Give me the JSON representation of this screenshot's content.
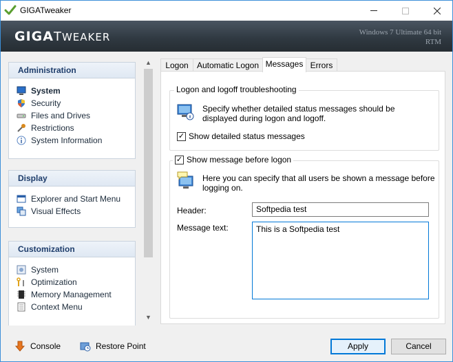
{
  "window": {
    "title": "GIGATweaker",
    "brand_first": "GIGA",
    "brand_t": "T",
    "brand_rest": "WEAKER",
    "os_line1": "Windows 7 Ultimate 64 bit",
    "os_line2": "RTM"
  },
  "sidebar": {
    "panels": [
      {
        "title": "Administration",
        "items": [
          {
            "label": "System",
            "icon": "monitor-icon",
            "selected": true
          },
          {
            "label": "Security",
            "icon": "shield-icon"
          },
          {
            "label": "Files and Drives",
            "icon": "drive-icon"
          },
          {
            "label": "Restrictions",
            "icon": "tools-icon"
          },
          {
            "label": "System Information",
            "icon": "info-icon"
          }
        ]
      },
      {
        "title": "Display",
        "items": [
          {
            "label": "Explorer and Start Menu",
            "icon": "explorer-icon"
          },
          {
            "label": "Visual Effects",
            "icon": "effects-icon"
          }
        ]
      },
      {
        "title": "Customization",
        "items": [
          {
            "label": "System",
            "icon": "system-settings-icon"
          },
          {
            "label": "Optimization",
            "icon": "wrench-icon"
          },
          {
            "label": "Memory Management",
            "icon": "memory-chip-icon"
          },
          {
            "label": "Context Menu",
            "icon": "context-menu-icon"
          }
        ]
      }
    ]
  },
  "tabs": [
    {
      "label": "Logon"
    },
    {
      "label": "Automatic Logon"
    },
    {
      "label": "Messages",
      "active": true
    },
    {
      "label": "Errors"
    }
  ],
  "messages": {
    "troubleshoot_title": "Logon and logoff troubleshooting",
    "troubleshoot_desc_1": "Specify whether detailed status messages should be",
    "troubleshoot_desc_2": "displayed during logon and logoff.",
    "show_detailed_label": "Show detailed status messages",
    "show_detailed_checked": true,
    "show_message_label": "Show message before logon",
    "show_message_checked": true,
    "message_desc_1": "Here you can specify that all users be shown a message before",
    "message_desc_2": "logging on.",
    "header_label": "Header:",
    "header_value": "Softpedia test",
    "message_text_label": "Message text:",
    "message_text_value": "This is a Softpedia test"
  },
  "footer": {
    "console_label": "Console",
    "restore_label": "Restore Point",
    "apply_label": "Apply",
    "cancel_label": "Cancel"
  },
  "colors": {
    "accent": "#0078d7",
    "panel_header": "#1e3d6b",
    "banner": "#2f3840"
  }
}
